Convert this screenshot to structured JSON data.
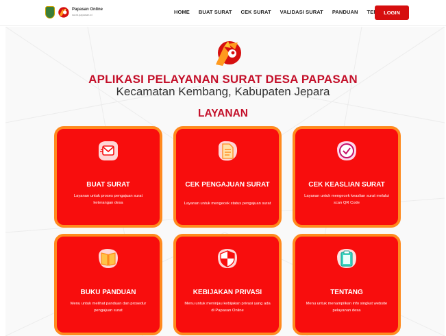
{
  "header": {
    "brand_title": "Papasan Online",
    "brand_sub": "surat.papasan.id",
    "nav": [
      "HOME",
      "BUAT SURAT",
      "CEK SURAT",
      "VALIDASI SURAT",
      "PANDUAN",
      "TENTANG"
    ],
    "login_label": "LOGIN"
  },
  "hero": {
    "title": "APLIKASI PELAYANAN SURAT DESA PAPASAN",
    "subtitle": "Kecamatan Kembang, Kabupaten Jepara",
    "section_title": "LAYANAN"
  },
  "cards": [
    {
      "title": "BUAT SURAT",
      "desc": "Layanan untuk proses pengajuan surat keterangan desa",
      "icon": "mail-icon"
    },
    {
      "title": "CEK PENGAJUAN SURAT",
      "desc": "Layanan untuk mengecek status pengajuan surat",
      "icon": "document-icon"
    },
    {
      "title": "CEK KEASLIAN SURAT",
      "desc": "Layanan untuk mengecek keaslian surat melalui scan QR Code",
      "icon": "check-circle-icon"
    },
    {
      "title": "BUKU PANDUAN",
      "desc": "Menu untuk melihat panduan dan prosedur pengajuan surat",
      "icon": "book-icon"
    },
    {
      "title": "KEBIJAKAN PRIVASI",
      "desc": "Menu untuk meninjau kebijakan privasi yang ada di Papasan Online",
      "icon": "shield-icon"
    },
    {
      "title": "TENTANG",
      "desc": "Menu untuk menampilkan info singkat website pelayanan desa",
      "icon": "clipboard-icon"
    }
  ],
  "colors": {
    "card_bg": "#f80d0d",
    "card_border": "#ff8a1e",
    "accent": "#c4102a",
    "login_bg": "#d60f0f"
  }
}
